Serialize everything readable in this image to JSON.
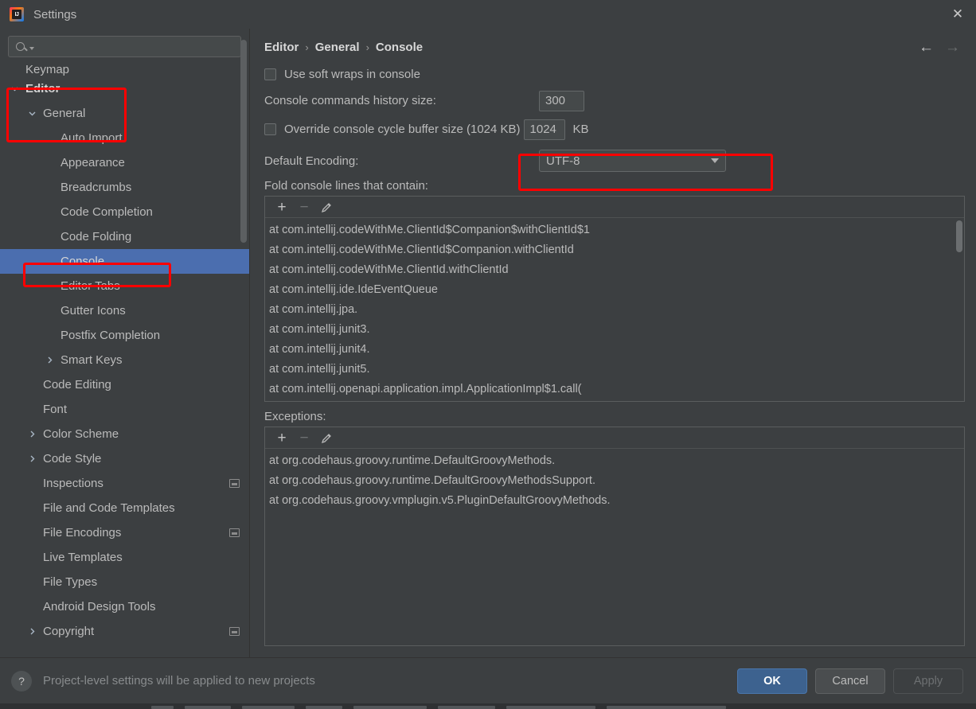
{
  "window": {
    "title": "Settings",
    "logo_icon": "intellij-idea-logo",
    "close_icon": "close-icon"
  },
  "sidebar": {
    "search": {
      "placeholder": "",
      "value": "",
      "icon": "search-icon",
      "caret_icon": "chevron-down-icon"
    },
    "items": [
      {
        "label": "Keymap",
        "indent": 0,
        "twisty": "none",
        "badge": false,
        "selected": false,
        "bold": false,
        "clipped": true
      },
      {
        "label": "Editor",
        "indent": 0,
        "twisty": "expanded",
        "badge": false,
        "selected": false,
        "bold": true,
        "clipped": false
      },
      {
        "label": "General",
        "indent": 1,
        "twisty": "expanded",
        "badge": false,
        "selected": false,
        "bold": false,
        "clipped": false
      },
      {
        "label": "Auto Import",
        "indent": 2,
        "twisty": "none",
        "badge": false,
        "selected": false,
        "bold": false,
        "clipped": false
      },
      {
        "label": "Appearance",
        "indent": 2,
        "twisty": "none",
        "badge": false,
        "selected": false,
        "bold": false,
        "clipped": false
      },
      {
        "label": "Breadcrumbs",
        "indent": 2,
        "twisty": "none",
        "badge": false,
        "selected": false,
        "bold": false,
        "clipped": false
      },
      {
        "label": "Code Completion",
        "indent": 2,
        "twisty": "none",
        "badge": false,
        "selected": false,
        "bold": false,
        "clipped": false
      },
      {
        "label": "Code Folding",
        "indent": 2,
        "twisty": "none",
        "badge": false,
        "selected": false,
        "bold": false,
        "clipped": false
      },
      {
        "label": "Console",
        "indent": 2,
        "twisty": "none",
        "badge": false,
        "selected": true,
        "bold": false,
        "clipped": false
      },
      {
        "label": "Editor Tabs",
        "indent": 2,
        "twisty": "none",
        "badge": false,
        "selected": false,
        "bold": false,
        "clipped": false
      },
      {
        "label": "Gutter Icons",
        "indent": 2,
        "twisty": "none",
        "badge": false,
        "selected": false,
        "bold": false,
        "clipped": false
      },
      {
        "label": "Postfix Completion",
        "indent": 2,
        "twisty": "none",
        "badge": false,
        "selected": false,
        "bold": false,
        "clipped": false
      },
      {
        "label": "Smart Keys",
        "indent": 2,
        "twisty": "collapsed",
        "badge": false,
        "selected": false,
        "bold": false,
        "clipped": false
      },
      {
        "label": "Code Editing",
        "indent": 1,
        "twisty": "none",
        "badge": false,
        "selected": false,
        "bold": false,
        "clipped": false
      },
      {
        "label": "Font",
        "indent": 1,
        "twisty": "none",
        "badge": false,
        "selected": false,
        "bold": false,
        "clipped": false
      },
      {
        "label": "Color Scheme",
        "indent": 1,
        "twisty": "collapsed",
        "badge": false,
        "selected": false,
        "bold": false,
        "clipped": false
      },
      {
        "label": "Code Style",
        "indent": 1,
        "twisty": "collapsed",
        "badge": false,
        "selected": false,
        "bold": false,
        "clipped": false
      },
      {
        "label": "Inspections",
        "indent": 1,
        "twisty": "none",
        "badge": true,
        "selected": false,
        "bold": false,
        "clipped": false
      },
      {
        "label": "File and Code Templates",
        "indent": 1,
        "twisty": "none",
        "badge": false,
        "selected": false,
        "bold": false,
        "clipped": false
      },
      {
        "label": "File Encodings",
        "indent": 1,
        "twisty": "none",
        "badge": true,
        "selected": false,
        "bold": false,
        "clipped": false
      },
      {
        "label": "Live Templates",
        "indent": 1,
        "twisty": "none",
        "badge": false,
        "selected": false,
        "bold": false,
        "clipped": false
      },
      {
        "label": "File Types",
        "indent": 1,
        "twisty": "none",
        "badge": false,
        "selected": false,
        "bold": false,
        "clipped": false
      },
      {
        "label": "Android Design Tools",
        "indent": 1,
        "twisty": "none",
        "badge": false,
        "selected": false,
        "bold": false,
        "clipped": false
      },
      {
        "label": "Copyright",
        "indent": 1,
        "twisty": "collapsed",
        "badge": true,
        "selected": false,
        "bold": false,
        "clipped": false
      }
    ]
  },
  "main": {
    "breadcrumb": [
      "Editor",
      "General",
      "Console"
    ],
    "breadcrumb_separator": "›",
    "nav": {
      "back_icon": "arrow-left-icon",
      "forward_icon": "arrow-right-icon",
      "back_enabled": true,
      "forward_enabled": false
    },
    "soft_wraps": {
      "label": "Use soft wraps in console",
      "checked": false
    },
    "history_size": {
      "label": "Console commands history size:",
      "value": "300"
    },
    "cycle_buffer": {
      "label": "Override console cycle buffer size (1024 KB)",
      "checked": false,
      "value": "1024",
      "unit": "KB"
    },
    "encoding": {
      "label": "Default Encoding:",
      "value": "UTF-8",
      "caret_icon": "chevron-down-icon"
    },
    "fold": {
      "label": "Fold console lines that contain:",
      "toolbar": {
        "add": "+",
        "remove": "−",
        "edit_icon": "pencil-icon"
      },
      "items": [
        "at com.intellij.codeWithMe.ClientId$Companion$withClientId$1",
        "at com.intellij.codeWithMe.ClientId$Companion.withClientId",
        "at com.intellij.codeWithMe.ClientId.withClientId",
        "at com.intellij.ide.IdeEventQueue",
        "at com.intellij.jpa.",
        "at com.intellij.junit3.",
        "at com.intellij.junit4.",
        "at com.intellij.junit5.",
        "at com.intellij.openapi.application.impl.ApplicationImpl$1.call("
      ]
    },
    "exceptions": {
      "label": "Exceptions:",
      "toolbar": {
        "add": "+",
        "remove": "−",
        "edit_icon": "pencil-icon"
      },
      "items": [
        "at org.codehaus.groovy.runtime.DefaultGroovyMethods.",
        "at org.codehaus.groovy.runtime.DefaultGroovyMethodsSupport.",
        "at org.codehaus.groovy.vmplugin.v5.PluginDefaultGroovyMethods."
      ]
    }
  },
  "footer": {
    "help_icon": "question-mark-icon",
    "status": "Project-level settings will be applied to new projects",
    "ok": "OK",
    "cancel": "Cancel",
    "apply": "Apply"
  },
  "colors": {
    "accent_selection": "#4b6eaf",
    "primary_button": "#3d628f",
    "annotation": "#ff0000",
    "background": "#3c3f41",
    "text": "#bbbbbb"
  }
}
